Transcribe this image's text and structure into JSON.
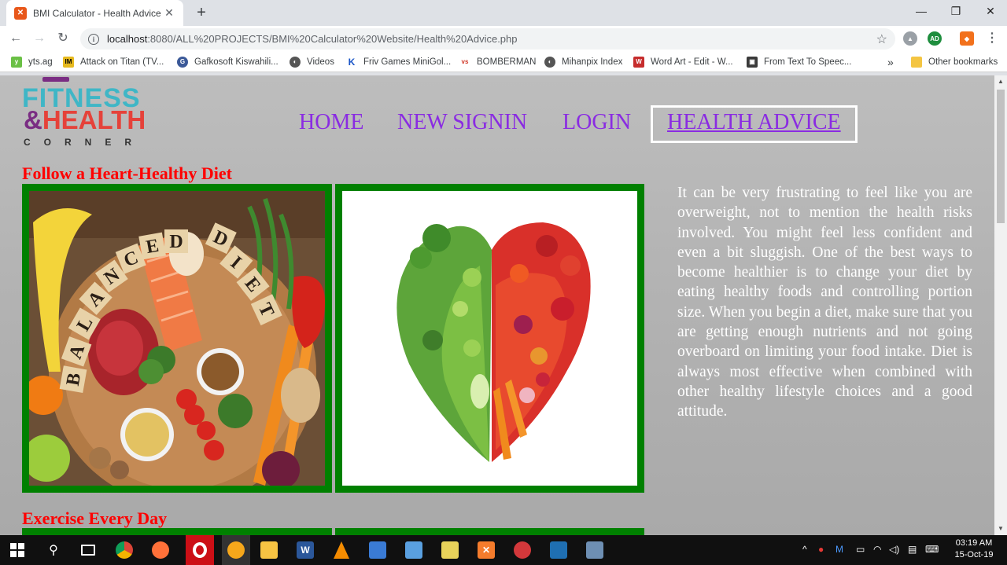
{
  "browser": {
    "tab_title": "BMI Calculator - Health Advice",
    "tab_favicon": "xampp-icon",
    "new_tab_label": "+",
    "url_host": "localhost",
    "url_path": ":8080/ALL%20PROJECTS/BMI%20Calculator%20Website/Health%20Advice.php",
    "bookmarks": [
      {
        "label": "yts.ag",
        "icon": "yts-icon",
        "color": "#6ac045"
      },
      {
        "label": "Attack on Titan (TV...",
        "icon": "imdb-icon",
        "color": "#e6b91e"
      },
      {
        "label": "Gafkosoft Kiswahili...",
        "icon": "globe-icon",
        "color": "#3b5998"
      },
      {
        "label": "Videos",
        "icon": "globe-icon",
        "color": "#555555"
      },
      {
        "label": "Friv Games MiniGol...",
        "icon": "k-icon",
        "color": "#1a55c7"
      },
      {
        "label": "BOMBERMAN",
        "icon": "vs-icon",
        "color": "#d13b2b"
      },
      {
        "label": "Mihanpix Index",
        "icon": "globe-icon",
        "color": "#555555"
      },
      {
        "label": "Word Art - Edit - W...",
        "icon": "w-icon",
        "color": "#c62d2d"
      },
      {
        "label": "From Text To Speec...",
        "icon": "tts-icon",
        "color": "#3a3a3a"
      }
    ],
    "more_bookmarks": "»",
    "other_bookmarks": "Other bookmarks"
  },
  "site": {
    "logo": {
      "line1": "FITNESS",
      "line2_amp": "&",
      "line2": "HEALTH",
      "line3": "CORNER"
    },
    "nav": [
      {
        "label": "HOME"
      },
      {
        "label": "NEW SIGNIN"
      },
      {
        "label": "LOGIN"
      },
      {
        "label": "HEALTH ADVICE"
      }
    ],
    "sections": [
      {
        "heading": "Follow a Heart-Healthy Diet",
        "image1_text": "BALANCED DIET",
        "paragraph": "It can be very frustrating to feel like you are overweight, not to mention the health risks involved. You might feel less confident and even a bit sluggish. One of the best ways to become healthier is to change your diet by eating healthy foods and controlling portion size. When you begin a diet, make sure that you are getting enough nutrients and not going overboard on limiting your food intake. Diet is always most effective when combined with other healthy lifestyle choices and a good attitude."
      },
      {
        "heading": "Exercise Every Day"
      }
    ],
    "frame_color": "#008000",
    "heading_color": "#ff0000",
    "nav_color": "#8a2be2"
  },
  "taskbar": {
    "time": "03:19 AM",
    "date": "15-Oct-19",
    "apps": [
      "start-icon",
      "search-icon",
      "task-view-icon",
      "chrome-icon",
      "firefox-icon",
      "opera-icon",
      "vlc-media-icon",
      "file-explorer-icon",
      "word-icon",
      "vlc-icon",
      "network-icon",
      "box-icon",
      "folder-icon",
      "xampp-icon",
      "media-icon",
      "remote-icon",
      "screen-icon"
    ]
  }
}
